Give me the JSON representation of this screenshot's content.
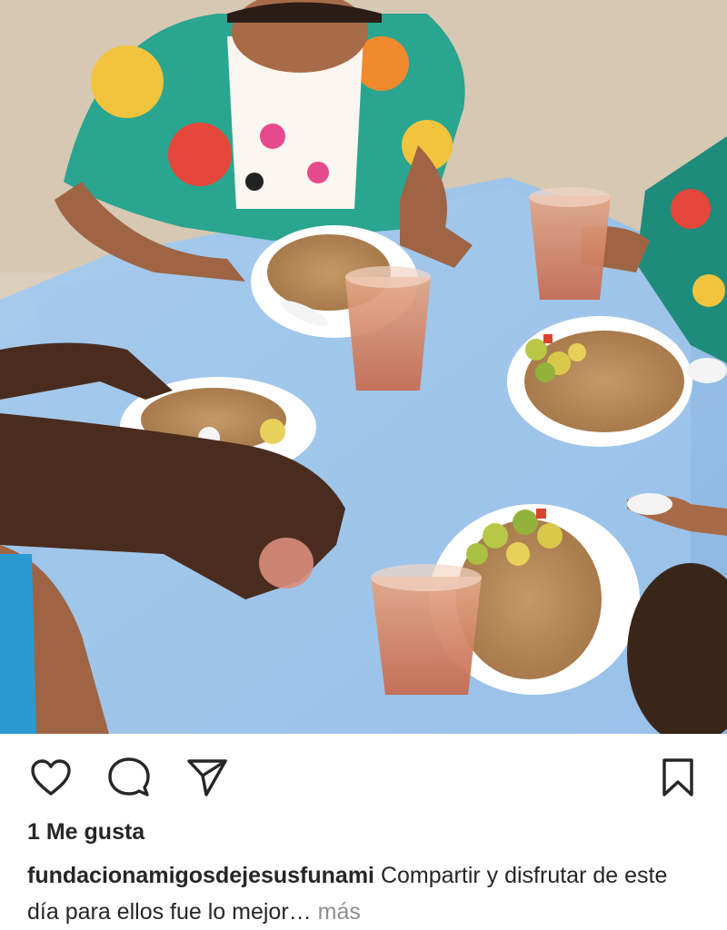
{
  "post": {
    "image_alt": "children eating rice with avocado salad and drinking iced tea at a blue table",
    "likes_text": "1 Me gusta",
    "username": "fundacionamigosdejesusfunami",
    "caption_text": "Compartir y disfrutar de este día para ellos fue lo mejor…",
    "more_label": "más"
  },
  "actions": {
    "like_icon": "heart-outline-icon",
    "comment_icon": "comment-bubble-icon",
    "share_icon": "paper-plane-icon",
    "save_icon": "bookmark-outline-icon"
  },
  "colors": {
    "text": "#262626",
    "secondary": "#8e8e8e",
    "table": "#9fc4ea",
    "sand": "#d9cdbb"
  }
}
